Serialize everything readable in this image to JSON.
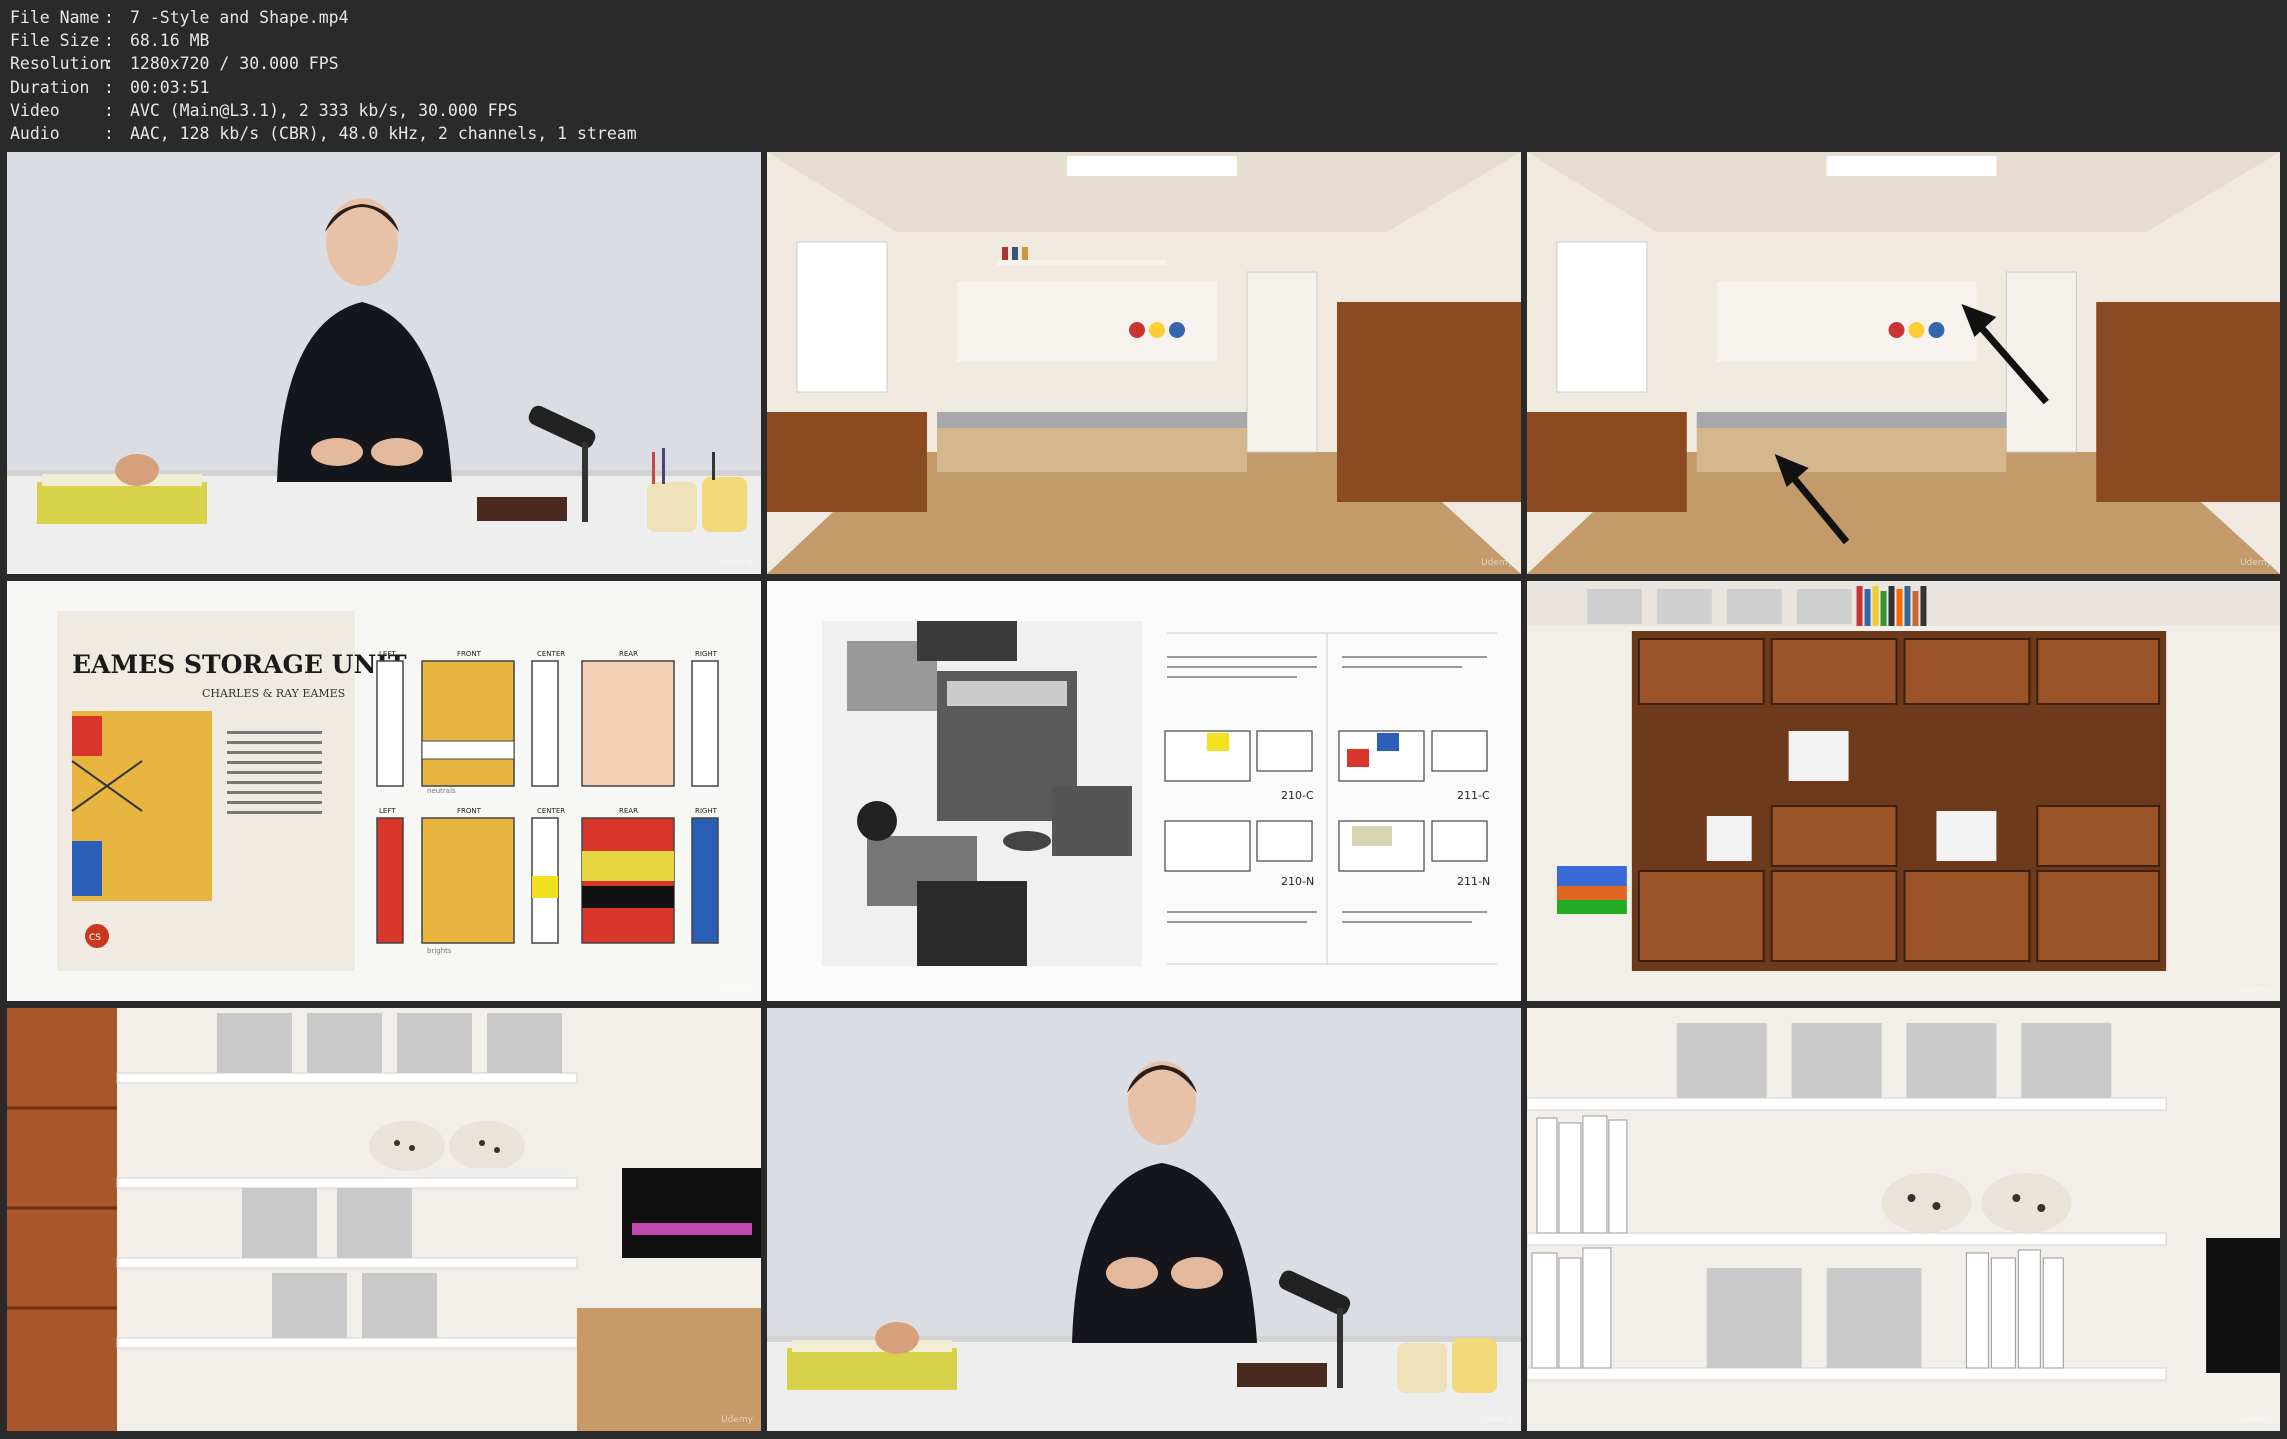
{
  "media_info": [
    {
      "key": "File Name",
      "value": "7 -Style and Shape.mp4"
    },
    {
      "key": "File Size",
      "value": "68.16 MB"
    },
    {
      "key": "Resolution",
      "value": "1280x720 / 30.000 FPS"
    },
    {
      "key": "Duration",
      "value": "00:03:51"
    },
    {
      "key": "Video",
      "value": "AVC (Main@L3.1), 2 333 kb/s, 30.000 FPS"
    },
    {
      "key": "Audio",
      "value": "AAC, 128 kb/s (CBR), 48.0 kHz, 2 channels, 1 stream"
    }
  ],
  "separator": ":",
  "watermark": "Udemy",
  "eames": {
    "title": "EAMES STORAGE UNIT",
    "subtitle": "CHARLES & RAY EAMES",
    "labels": [
      "LEFT",
      "FRONT",
      "CENTER",
      "REAR",
      "RIGHT"
    ],
    "row1_caption": "neutrals",
    "row2_caption": "brights",
    "badge": "CS"
  },
  "catalog": {
    "model_1": "210-C",
    "model_2": "211-C",
    "model_3": "210-N",
    "model_4": "211-N"
  },
  "colors": {
    "background": "#2a2a2a",
    "info_text": "#e6e6e6",
    "wood": "#8a4a22",
    "eames_yellow": "#e8b640",
    "eames_red": "#d8362a",
    "eames_blue": "#2a5fb8"
  }
}
